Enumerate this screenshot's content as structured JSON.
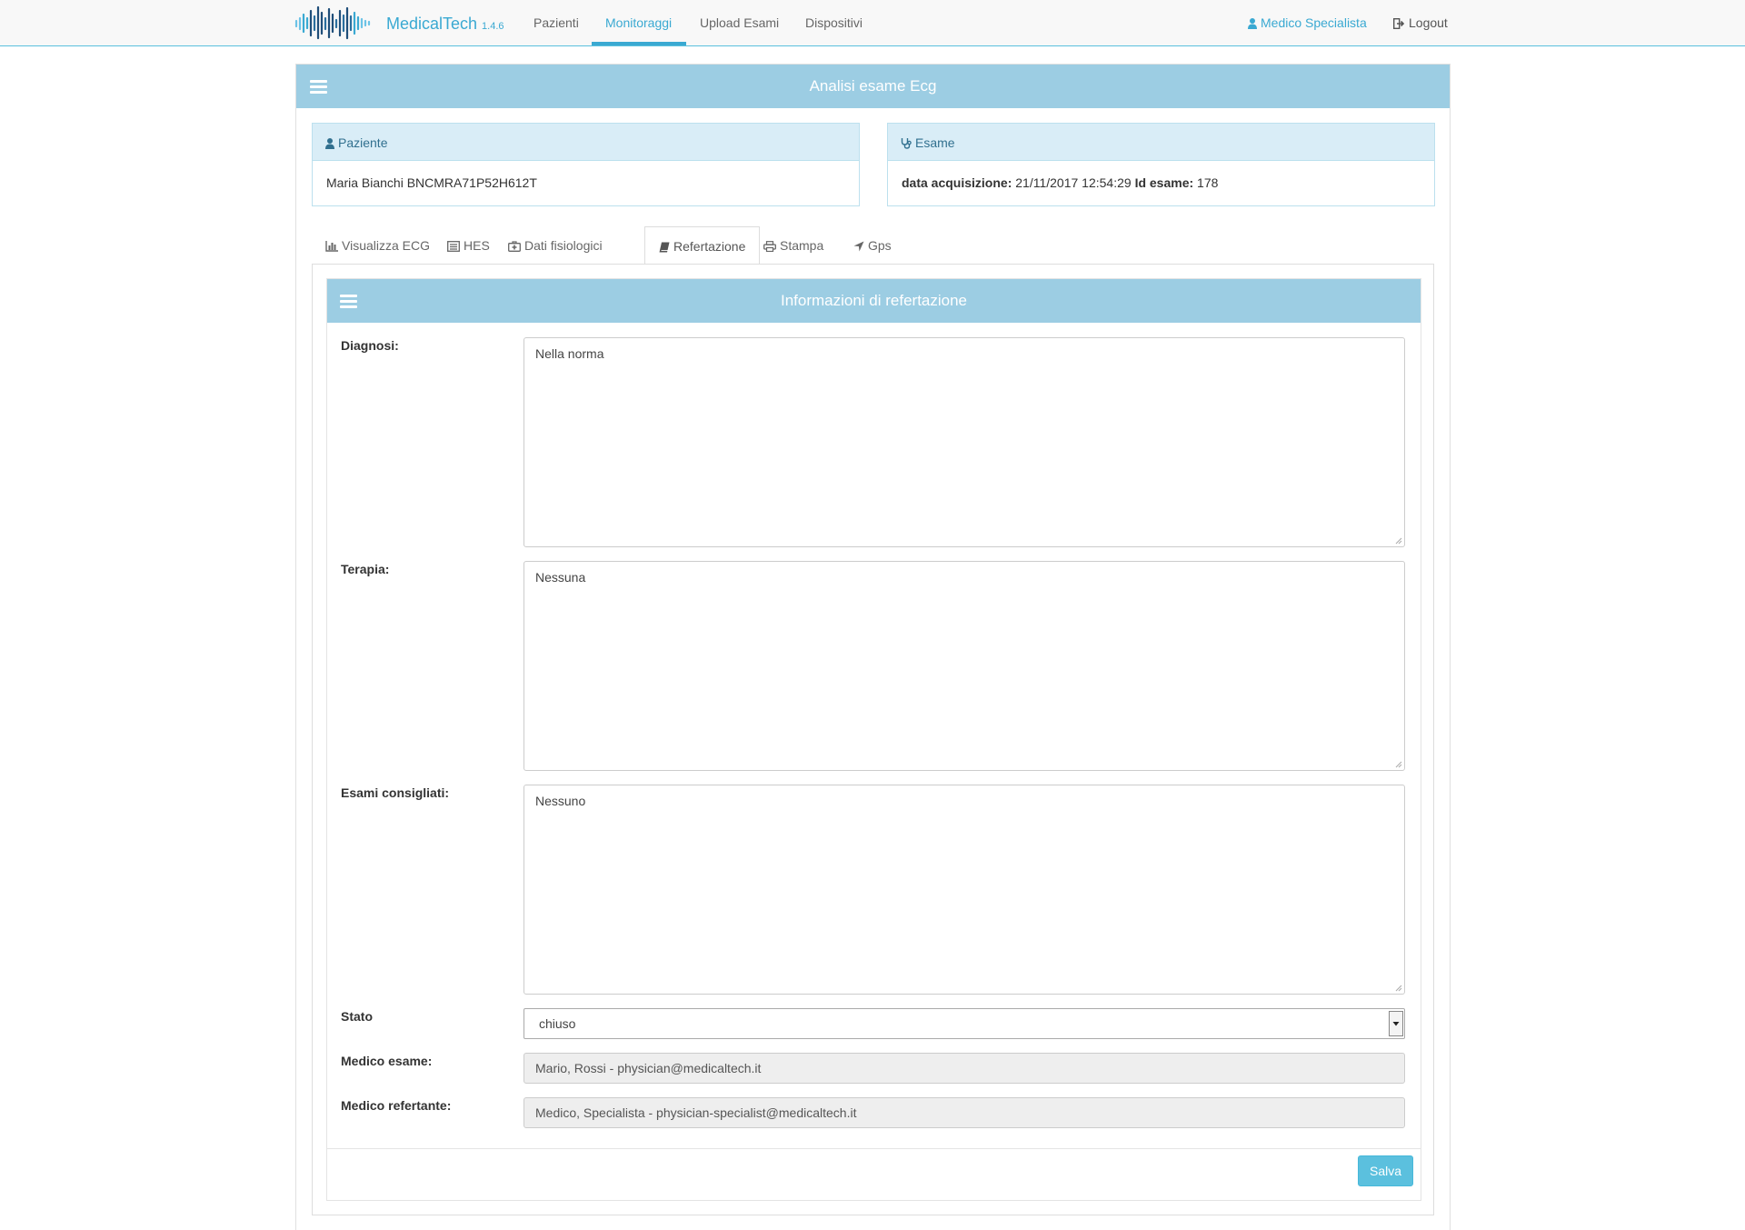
{
  "navbar": {
    "brand_name": "MedicalTech",
    "brand_version": "1.4.6",
    "links": [
      "Pazienti",
      "Monitoraggi",
      "Upload Esami",
      "Dispositivi"
    ],
    "active_link": "Monitoraggi",
    "user_label": "Medico Specialista",
    "logout_label": "Logout"
  },
  "page": {
    "title": "Analisi esame Ecg"
  },
  "patient_panel": {
    "heading": "Paziente",
    "value": "Maria Bianchi BNCMRA71P52H612T"
  },
  "exam_panel": {
    "heading": "Esame",
    "acq_label": "data acquisizione:",
    "acq_value": "21/11/2017 12:54:29",
    "id_label": "Id esame:",
    "id_value": "178"
  },
  "tabs": [
    "Visualizza ECG",
    "HES",
    "Dati fisiologici",
    "Refertazione",
    "Stampa",
    "Gps"
  ],
  "active_tab": "Refertazione",
  "report": {
    "title": "Informazioni di refertazione",
    "diagnosi_label": "Diagnosi:",
    "diagnosi_value": "Nella norma",
    "terapia_label": "Terapia:",
    "terapia_value": "Nessuna",
    "esami_label": "Esami consigliati:",
    "esami_value": "Nessuno",
    "stato_label": "Stato",
    "stato_value": "chiuso",
    "medico_esame_label": "Medico esame:",
    "medico_esame_value": "Mario, Rossi - physician@medicaltech.it",
    "medico_referente_label": "Medico refertante:",
    "medico_referente_value": "Medico, Specialista - physician-specialist@medicaltech.it",
    "save_label": "Salva"
  },
  "colors": {
    "accent": "#3aa9d2",
    "panel_header": "#9ccde3",
    "info_header_bg": "#d9edf7",
    "save_button": "#5bc0de"
  }
}
